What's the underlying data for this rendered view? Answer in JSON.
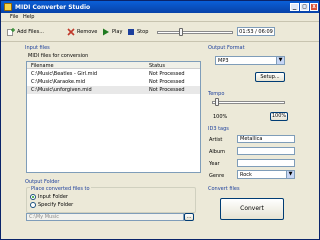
{
  "window": {
    "title": "MIDI Converter Studio",
    "minimize": "_",
    "maximize": "□",
    "close": "x"
  },
  "menu": {
    "file": "File",
    "help": "Help"
  },
  "toolbar": {
    "add_files": "Add Files...",
    "remove": "Remove",
    "play": "Play",
    "stop": "Stop",
    "time": "01:53 / 06:09",
    "progress_fraction": 0.31
  },
  "input_files": {
    "section_title": "Input files",
    "subtitle": "MIDI files for conversion",
    "columns": [
      "Filename",
      "Status"
    ],
    "rows": [
      {
        "filename": "C:\\Music\\Beatles - Girl.mid",
        "status": "Not Processed"
      },
      {
        "filename": "C:\\Music\\Karaoke.mid",
        "status": "Not Processed"
      },
      {
        "filename": "C:\\Music\\unforgiven.mid",
        "status": "Not Processed"
      }
    ]
  },
  "output_format": {
    "section_title": "Output Format",
    "selected": "MP3",
    "setup_button": "Setup..."
  },
  "tempo": {
    "section_title": "Tempo",
    "value_label": "100%",
    "reset_button": "100%",
    "level_fraction": 0.05
  },
  "id3": {
    "section_title": "ID3 tags",
    "artist_label": "Artist",
    "artist_value": "Metallica",
    "album_label": "Album",
    "album_value": "",
    "year_label": "Year",
    "year_value": "",
    "genre_label": "Genre",
    "genre_value": "Rock"
  },
  "convert": {
    "section_title": "Convert files",
    "button": "Convert"
  },
  "output_folder": {
    "section_title": "Output Folder",
    "group_title": "Place converted files to",
    "option_input": "Input Folder",
    "option_specify": "Specify Folder",
    "path_placeholder": "C:\\My Music",
    "browse": "..."
  }
}
